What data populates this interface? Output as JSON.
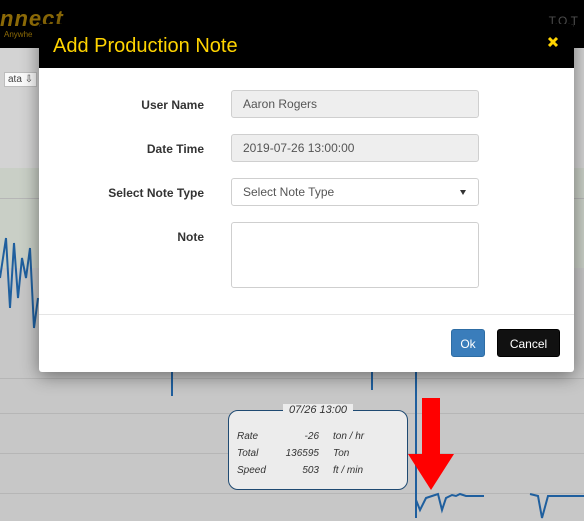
{
  "app": {
    "brand": "nnect",
    "brand_sub": "Anywhe",
    "data_button": "ata",
    "top_right": "T.O.T"
  },
  "dialog": {
    "title": "Add Production Note",
    "close_icon": "close-icon",
    "fields": {
      "user_name": {
        "label": "User Name",
        "value": "Aaron Rogers"
      },
      "date_time": {
        "label": "Date Time",
        "value": "2019-07-26 13:00:00"
      },
      "note_type": {
        "label": "Select Note Type",
        "selected": "Select Note Type"
      },
      "note": {
        "label": "Note",
        "value": ""
      }
    },
    "buttons": {
      "ok": "Ok",
      "cancel": "Cancel"
    }
  },
  "tooltip": {
    "title": "07/26 13:00",
    "rows": [
      {
        "label": "Rate",
        "value": "-26",
        "unit": "ton / hr"
      },
      {
        "label": "Total",
        "value": "136595",
        "unit": "Ton"
      },
      {
        "label": "Speed",
        "value": "503",
        "unit": "ft / min"
      }
    ]
  },
  "colors": {
    "header_bg": "#000000",
    "title_color": "#ffd400",
    "ok_button": "#3a7dbb",
    "cancel_button": "#111111",
    "series_line": "#1f5f9e",
    "arrow": "#ff0000"
  }
}
